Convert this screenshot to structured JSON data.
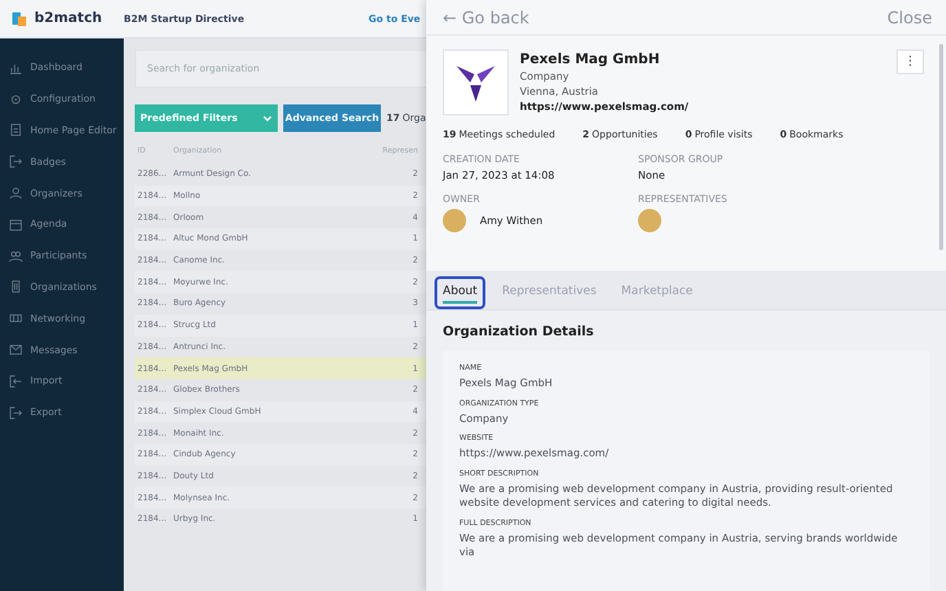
{
  "header": {
    "brand": "b2match",
    "event_title": "B2M Startup Directive",
    "link": "Go to Eve"
  },
  "sidebar": {
    "items": [
      {
        "label": "Dashboard",
        "selected": false
      },
      {
        "label": "Configuration",
        "selected": false
      },
      {
        "label": "Home Page Editor",
        "selected": false
      },
      {
        "label": "Badges",
        "selected": false
      },
      {
        "label": "Organizers",
        "selected": false
      },
      {
        "label": "Agenda",
        "selected": false
      },
      {
        "label": "Participants",
        "selected": false
      },
      {
        "label": "Organizations",
        "selected": false
      },
      {
        "label": "Networking",
        "selected": false
      },
      {
        "label": "Messages",
        "selected": false
      },
      {
        "label": "Import",
        "selected": false
      },
      {
        "label": "Export",
        "selected": false
      }
    ]
  },
  "search": {
    "placeholder": "Search for organization"
  },
  "filters": {
    "dropdown": "Predefined Filters",
    "button": "Advanced Search",
    "count": "17",
    "count_label": "Orga"
  },
  "table": {
    "columns": [
      "ID",
      "Organization",
      "Represen"
    ],
    "rows": [
      {
        "cells": [
          "2286...",
          "Armunt Design Co.",
          "2"
        ],
        "selected": false
      },
      {
        "cells": [
          "2184...",
          "Mollno",
          "2"
        ],
        "selected": false
      },
      {
        "cells": [
          "2184...",
          "Orloom",
          "4"
        ],
        "selected": false
      },
      {
        "cells": [
          "2184...",
          "Altuc Mond GmbH",
          "1"
        ],
        "selected": false
      },
      {
        "cells": [
          "2184...",
          "Canome Inc.",
          "2"
        ],
        "selected": false
      },
      {
        "cells": [
          "2184...",
          "Moyurwe Inc.",
          "2"
        ],
        "selected": false
      },
      {
        "cells": [
          "2184...",
          "Buro Agency",
          "3"
        ],
        "selected": false
      },
      {
        "cells": [
          "2184...",
          "Strucg Ltd",
          "1"
        ],
        "selected": false
      },
      {
        "cells": [
          "2184...",
          "Antrunci Inc.",
          "2"
        ],
        "selected": false
      },
      {
        "cells": [
          "2184...",
          "Pexels Mag GmbH",
          "1"
        ],
        "selected": true
      },
      {
        "cells": [
          "2184...",
          "Globex Brothers",
          "2"
        ],
        "selected": false
      },
      {
        "cells": [
          "2184...",
          "Simplex Cloud GmbH",
          "4"
        ],
        "selected": false
      },
      {
        "cells": [
          "2184...",
          "Monaiht Inc.",
          "2"
        ],
        "selected": false
      },
      {
        "cells": [
          "2184...",
          "Cindub Agency",
          "2"
        ],
        "selected": false
      },
      {
        "cells": [
          "2184...",
          "Douty Ltd",
          "2"
        ],
        "selected": false
      },
      {
        "cells": [
          "2184...",
          "Molynsea Inc.",
          "2"
        ],
        "selected": false
      },
      {
        "cells": [
          "2184...",
          "Urbyg Inc.",
          "1"
        ],
        "selected": false
      }
    ]
  },
  "panel": {
    "back": "← Go back",
    "close": "Close",
    "org": {
      "name": "Pexels Mag GmbH",
      "type": "Company",
      "location": "Vienna, Austria",
      "website": "https://www.pexelsmag.com/",
      "menu": "⋮"
    },
    "stats": [
      {
        "value": "19",
        "label": "Meetings scheduled"
      },
      {
        "value": "2",
        "label": "Opportunities"
      },
      {
        "value": "0",
        "label": "Profile visits"
      },
      {
        "value": "0",
        "label": "Bookmarks"
      }
    ],
    "facts": [
      {
        "label": "CREATION DATE",
        "value": "Jan 27, 2023 at 14:08"
      },
      {
        "label": "SPONSOR GROUP",
        "value": "None"
      }
    ],
    "owner": {
      "label": "OWNER",
      "name": "Amy Withen"
    },
    "representatives": {
      "label": "REPRESENTATIVES"
    },
    "tabs": [
      {
        "label": "About",
        "selected": true
      },
      {
        "label": "Representatives",
        "selected": false
      },
      {
        "label": "Marketplace",
        "selected": false
      }
    ],
    "section_title": "Organization Details",
    "details": [
      {
        "label": "NAME",
        "value": "Pexels Mag GmbH"
      },
      {
        "label": "ORGANIZATION TYPE",
        "value": "Company"
      },
      {
        "label": "WEBSITE",
        "value": "https://www.pexelsmag.com/"
      },
      {
        "label": "SHORT DESCRIPTION",
        "value": "We are a promising web development company in Austria, providing result-oriented website development services and catering to digital needs."
      },
      {
        "label": "FULL DESCRIPTION",
        "value": "We are a promising web development company in Austria, serving brands worldwide via"
      }
    ]
  }
}
